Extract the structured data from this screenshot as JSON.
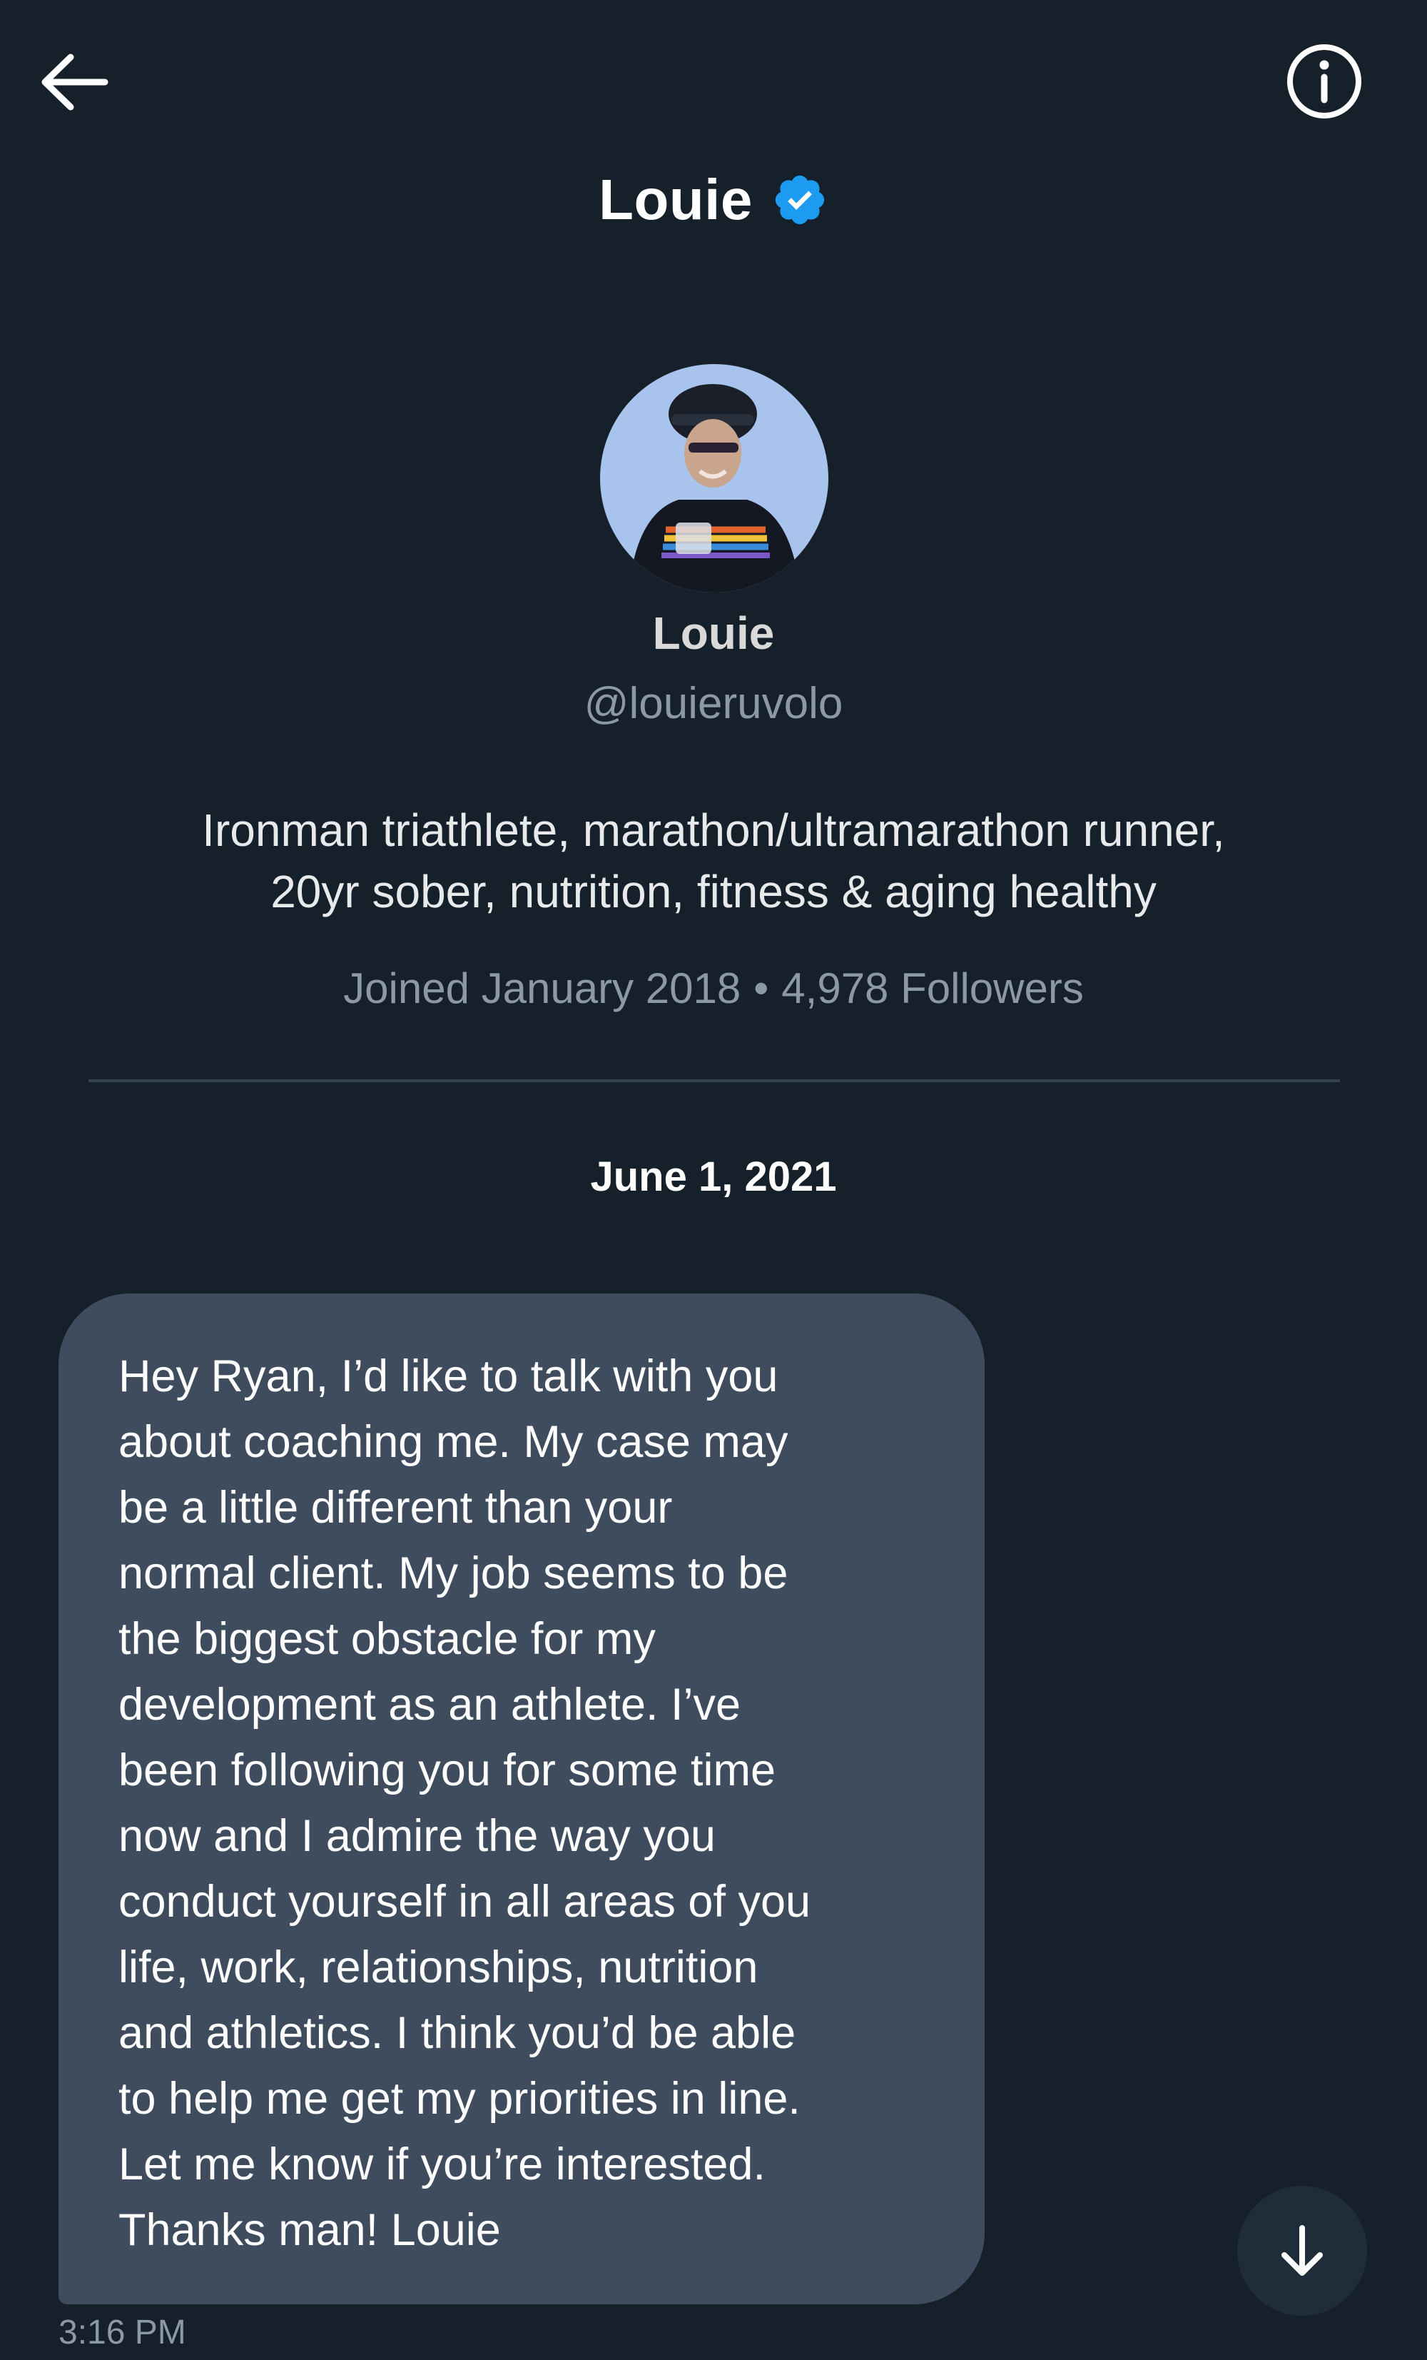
{
  "header": {
    "title": "Louie",
    "verified_color": "#1d9bf0",
    "back_icon": "arrow-left-icon",
    "info_icon": "info-circle-icon"
  },
  "profile": {
    "name": "Louie",
    "handle": "@louieruvolo",
    "bio_line1": "Ironman triathlete, marathon/ultramarathon runner,",
    "bio_line2": "20yr sober, nutrition, fitness & aging healthy",
    "joined": "Joined January 2018",
    "separator": "•",
    "followers": "4,978 Followers"
  },
  "conversation": {
    "date": "June 1, 2021",
    "message": {
      "text": "Hey Ryan, I’d like to talk with you\nabout coaching me. My case may\nbe a little different than your\nnormal client. My job seems to be\nthe biggest obstacle for my\ndevelopment as an athlete. I’ve\nbeen following you for some time\nnow and I admire the way you\nconduct yourself in all areas of you\nlife, work, relationships, nutrition\nand athletics. I think you’d be able\nto help me get my priorities in line.\nLet me know if you’re interested.\nThanks man! Louie",
      "time": "3:16 PM"
    },
    "scroll_icon": "arrow-down-icon"
  },
  "colors": {
    "background": "#15202b",
    "bubble": "#3e4c5e",
    "secondary_text": "#8b98a5",
    "accent": "#1d9bf0"
  }
}
